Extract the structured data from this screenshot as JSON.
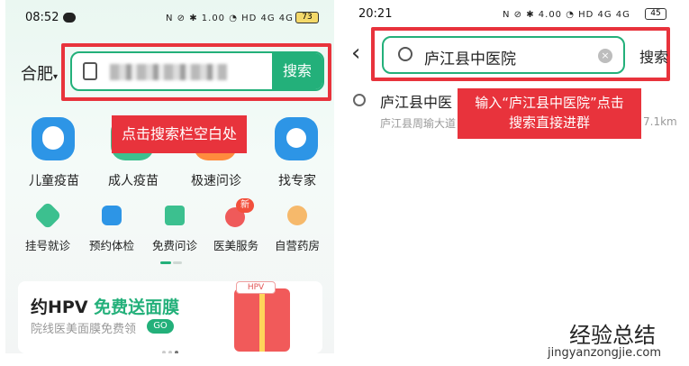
{
  "left": {
    "status_time": "08:52",
    "status_icons": "N ⊘ ✱ 1.00 ◔ HD 4G 4G",
    "battery": "73",
    "city": "合肥",
    "search_button": "搜索",
    "callout": "点击搜索栏空白处",
    "big_items": [
      "儿童疫苗",
      "成人疫苗",
      "极速问诊",
      "找专家"
    ],
    "small_items": [
      "挂号就诊",
      "预约体检",
      "免费问诊",
      "医美服务",
      "自营药房"
    ],
    "new_badge": "新",
    "banner_title_a": "约HPV",
    "banner_title_b": "免费送面膜",
    "banner_sub": "院线医美面膜免费领",
    "banner_go": "GO",
    "banner_card_text": "HPV"
  },
  "right": {
    "status_time": "20:21",
    "status_icons": "N ⊘ ✱ 4.00 ◔ HD 4G 4G",
    "battery": "45",
    "search_value": "庐江县中医院",
    "search_button": "搜索",
    "result_title": "庐江县中医",
    "result_sub": "庐江县周瑜大道",
    "result_distance": "7.1km",
    "callout_line1": "输入“庐江县中医院”点击",
    "callout_line2": "搜索直接进群"
  },
  "watermark": {
    "title": "经验总结",
    "url": "jingyanzongjie.com"
  },
  "colors": {
    "accent_green": "#23b07a",
    "highlight_red": "#e8333c",
    "icon_blue": "#2f9ae8"
  }
}
